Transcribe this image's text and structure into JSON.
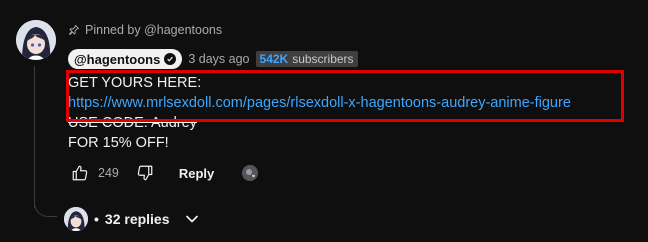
{
  "comment": {
    "pinned_text": "Pinned by @hagentoons",
    "author": "@hagentoons",
    "timestamp": "3 days ago",
    "subscriber_count": "542K",
    "subscriber_label": "subscribers",
    "lines": {
      "line1": "GET YOURS HERE:",
      "link": "https://www.mrlsexdoll.com/pages/rlsexdoll-x-hagentoons-audrey-anime-figure",
      "line3": "USE CODE: Audrey",
      "line4": "FOR 15% OFF!"
    },
    "like_count": "249",
    "reply_label": "Reply",
    "replies_label": "32 replies"
  },
  "colors": {
    "background": "#0f0f0f",
    "link": "#3ea6ff",
    "highlight_box": "#e00000"
  }
}
